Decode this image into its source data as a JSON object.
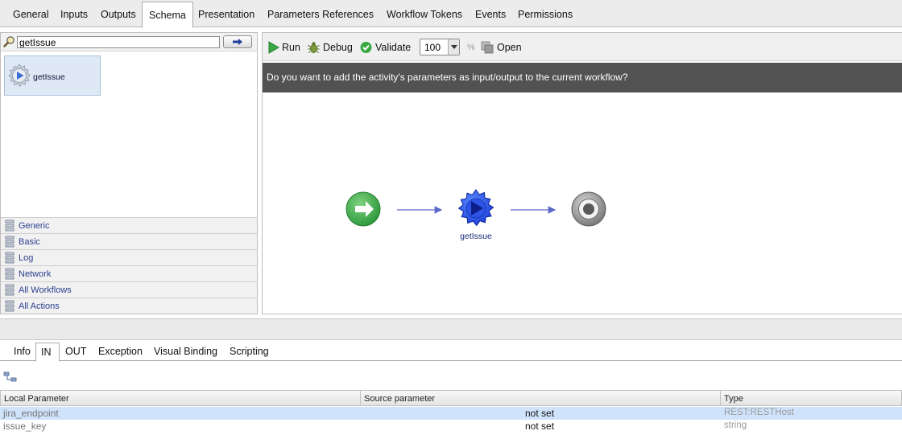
{
  "top_tabs": [
    {
      "label": "General"
    },
    {
      "label": "Inputs"
    },
    {
      "label": "Outputs"
    },
    {
      "label": "Schema",
      "active": true
    },
    {
      "label": "Presentation"
    },
    {
      "label": "Parameters References"
    },
    {
      "label": "Workflow Tokens"
    },
    {
      "label": "Events"
    },
    {
      "label": "Permissions"
    }
  ],
  "palette": {
    "search_value": "getIssue",
    "search_icon": "magnifier-icon",
    "go_icon": "arrow-right-icon",
    "result_item": {
      "label": "getIssue",
      "icon": "action-gear-icon"
    },
    "categories": [
      {
        "label": "Generic"
      },
      {
        "label": "Basic"
      },
      {
        "label": "Log"
      },
      {
        "label": "Network"
      },
      {
        "label": "All Workflows"
      },
      {
        "label": "All Actions"
      }
    ]
  },
  "toolbar": {
    "run_label": "Run",
    "debug_label": "Debug",
    "validate_label": "Validate",
    "zoom_value": "100",
    "zoom_unit": "%",
    "open_label": "Open"
  },
  "banner": {
    "text": "Do you want to add the activity's parameters as input/output to the current workflow?"
  },
  "workflow": {
    "start_icon": "start-arrow-icon",
    "node_label": "getIssue",
    "node_icon": "action-gear-icon",
    "end_icon": "end-target-icon",
    "accent_color": "#2244dd",
    "start_color": "#3aa845"
  },
  "bottom_tabs": [
    {
      "label": "Info"
    },
    {
      "label": "IN",
      "active": true
    },
    {
      "label": "OUT"
    },
    {
      "label": "Exception"
    },
    {
      "label": "Visual Binding"
    },
    {
      "label": "Scripting"
    }
  ],
  "table": {
    "columns": [
      "Local Parameter",
      "Source parameter",
      "Type"
    ],
    "rows": [
      {
        "local": "jira_endpoint",
        "source": "not set",
        "type": "REST:RESTHost",
        "selected": true
      },
      {
        "local": "issue_key",
        "source": "not set",
        "type": "string",
        "selected": false
      }
    ]
  }
}
